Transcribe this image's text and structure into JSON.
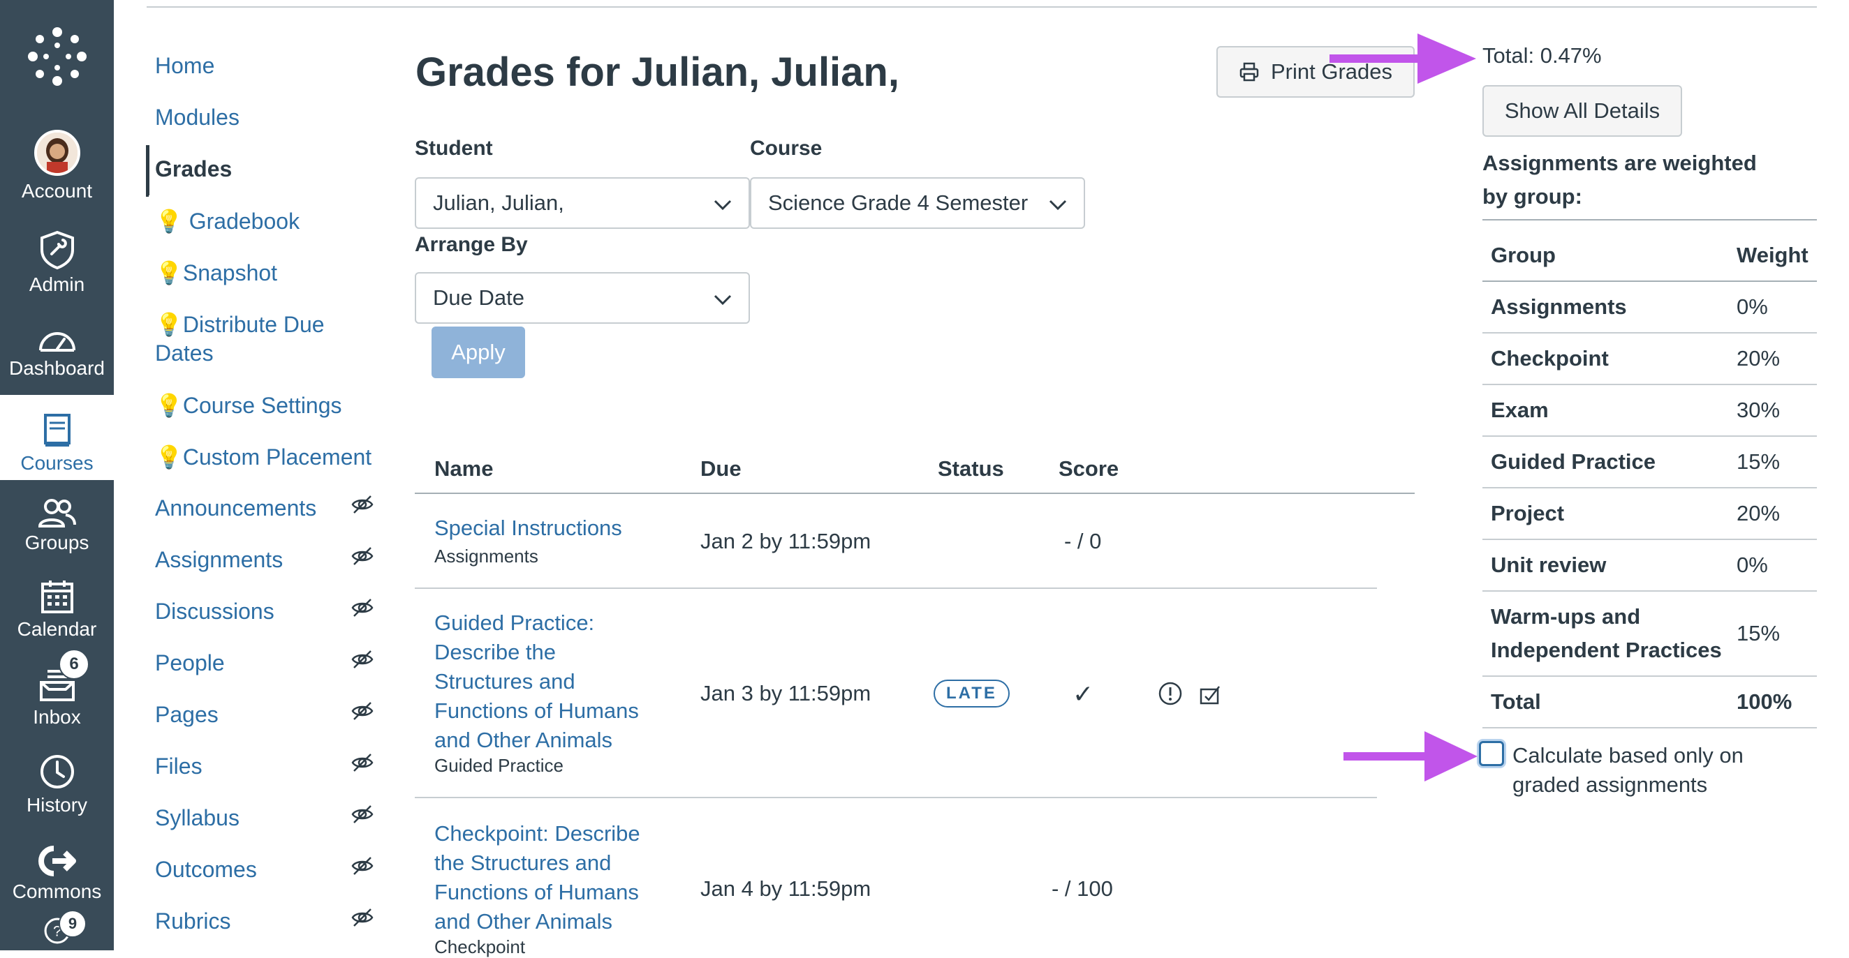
{
  "global_nav": {
    "account": "Account",
    "admin": "Admin",
    "dashboard": "Dashboard",
    "courses": "Courses",
    "groups": "Groups",
    "calendar": "Calendar",
    "inbox": "Inbox",
    "inbox_badge": "6",
    "history": "History",
    "commons": "Commons",
    "help_badge": "9"
  },
  "course_nav": {
    "items": [
      {
        "label": "Home"
      },
      {
        "label": "Modules"
      },
      {
        "label": "Grades"
      },
      {
        "label": "💡 Gradebook"
      },
      {
        "label": "💡Snapshot"
      },
      {
        "label": "💡Distribute Due"
      },
      {
        "label": "Dates"
      },
      {
        "label": "💡Course Settings"
      },
      {
        "label": "💡Custom Placement"
      },
      {
        "label": "Announcements"
      },
      {
        "label": "Assignments"
      },
      {
        "label": "Discussions"
      },
      {
        "label": "People"
      },
      {
        "label": "Pages"
      },
      {
        "label": "Files"
      },
      {
        "label": "Syllabus"
      },
      {
        "label": "Outcomes"
      },
      {
        "label": "Rubrics"
      }
    ]
  },
  "main": {
    "title": "Grades for Julian, Julian,",
    "print_button": "Print Grades",
    "student_label": "Student",
    "student_value": "Julian, Julian,",
    "course_label": "Course",
    "course_value": "Science Grade 4 Semester",
    "arrange_label": "Arrange By",
    "arrange_value": "Due Date",
    "apply_button": "Apply"
  },
  "table": {
    "headers": {
      "name": "Name",
      "due": "Due",
      "status": "Status",
      "score": "Score"
    },
    "rows": [
      {
        "name": "Special Instructions",
        "group": "Assignments",
        "due": "Jan 2 by 11:59pm",
        "status": "",
        "score": "- / 0"
      },
      {
        "name_lines": [
          "Guided Practice:",
          "Describe the",
          "Structures and",
          "Functions of Humans",
          "and Other Animals"
        ],
        "group": "Guided Practice",
        "due": "Jan 3 by 11:59pm",
        "status": "LATE",
        "score": "✓"
      },
      {
        "name_lines": [
          "Checkpoint: Describe",
          "the Structures and",
          "Functions of Humans",
          "and Other Animals"
        ],
        "group": "Checkpoint",
        "due": "Jan 4 by 11:59pm",
        "status": "",
        "score": "- / 100"
      }
    ]
  },
  "sidebar": {
    "total": "Total: 0.47%",
    "show_all_details": "Show All Details",
    "weighted_text": "Assignments are weighted by group:",
    "weights_header": {
      "group": "Group",
      "weight": "Weight"
    },
    "weights": [
      {
        "group": "Assignments",
        "weight": "0%"
      },
      {
        "group": "Checkpoint",
        "weight": "20%"
      },
      {
        "group": "Exam",
        "weight": "30%"
      },
      {
        "group": "Guided Practice",
        "weight": "15%"
      },
      {
        "group": "Project",
        "weight": "20%"
      },
      {
        "group": "Unit review",
        "weight": "0%"
      },
      {
        "group": "Warm-ups and",
        "weight": "15%"
      },
      {
        "group": "Independent Practices",
        "weight": ""
      }
    ],
    "weights_total": {
      "group": "Total",
      "weight": "100%"
    },
    "calc_checkbox_label": "Calculate based only on graded assignments"
  },
  "colors": {
    "nav_bg": "#394b58",
    "link": "#2d6ea5",
    "arrow": "#c155ea",
    "apply": "#8fb3d9"
  }
}
